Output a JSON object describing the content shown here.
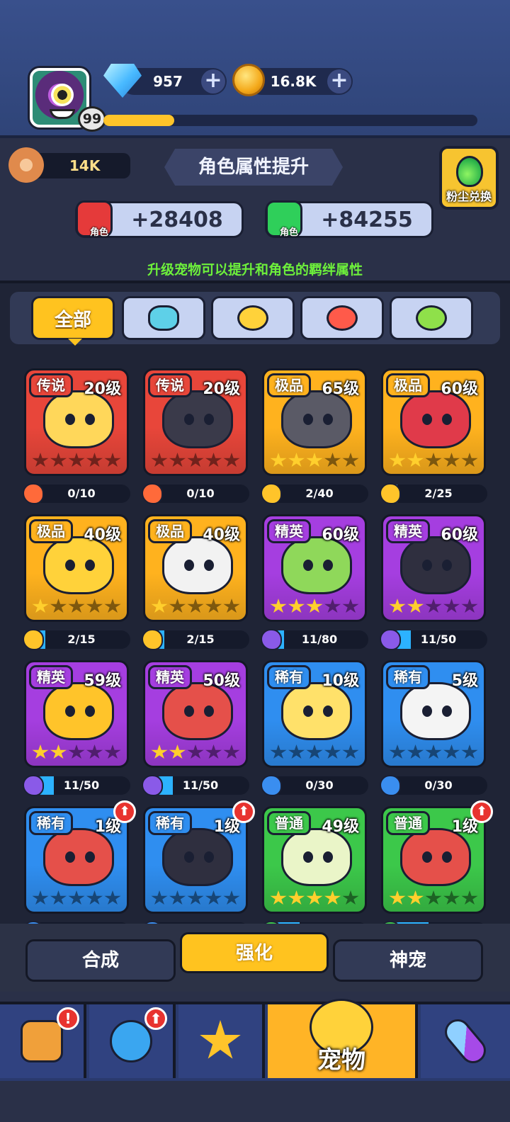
{
  "player": {
    "level": "99",
    "xp_progress": 0.19
  },
  "currencies": {
    "gems": "957",
    "coins": "16.8K",
    "plus": "+"
  },
  "dust": {
    "amount": "14K"
  },
  "header": {
    "title": "角色属性提升",
    "exchange_label": "粉尘兑换"
  },
  "stats": [
    {
      "icon": "sword-icon",
      "icon_label": "角色",
      "value": "+28408",
      "color": "#e53a3a"
    },
    {
      "icon": "heart-icon",
      "icon_label": "角色",
      "value": "+84255",
      "color": "#2fcf5a"
    }
  ],
  "hint": "升级宠物可以提升和角色的羁绊属性",
  "filter_tabs": [
    {
      "label": "全部",
      "icon": "all",
      "active": true
    },
    {
      "label": "",
      "icon": "robot-face-icon",
      "color": "#5ed0e8"
    },
    {
      "label": "",
      "icon": "chick-icon",
      "color": "#ffd23a"
    },
    {
      "label": "",
      "icon": "fire-blob-icon",
      "color": "#ff5a4a"
    },
    {
      "label": "",
      "icon": "dragon-icon",
      "color": "#8fe04a"
    }
  ],
  "pets": [
    {
      "rarity": "传说",
      "level": "20级",
      "stars": 0,
      "progress": "0/10",
      "fill": 0,
      "bg": "#e8463a",
      "art": "#ffd75a",
      "shard": "#ff6a3a",
      "tag": "#e8463a"
    },
    {
      "rarity": "传说",
      "level": "20级",
      "stars": 0,
      "progress": "0/10",
      "fill": 0,
      "bg": "#e8463a",
      "art": "#3a3a4a",
      "shard": "#ff6a3a",
      "tag": "#e8463a"
    },
    {
      "rarity": "极品",
      "level": "65级",
      "stars": 3,
      "progress": "2/40",
      "fill": 0.05,
      "bg": "#ffb21e",
      "art": "#5a5a66",
      "shard": "#ffc42a",
      "tag": "#ffb21e"
    },
    {
      "rarity": "极品",
      "level": "60级",
      "stars": 2,
      "progress": "2/25",
      "fill": 0.08,
      "bg": "#ffb21e",
      "art": "#e03a4a",
      "shard": "#ffc42a",
      "tag": "#ffb21e"
    },
    {
      "rarity": "极品",
      "level": "40级",
      "stars": 1,
      "progress": "2/15",
      "fill": 0.13,
      "bg": "#ffb21e",
      "art": "#ffd23a",
      "shard": "#ffc42a",
      "tag": "#ffb21e"
    },
    {
      "rarity": "极品",
      "level": "40级",
      "stars": 1,
      "progress": "2/15",
      "fill": 0.13,
      "bg": "#ffb21e",
      "art": "#f2f2f2",
      "shard": "#ffc42a",
      "tag": "#ffb21e"
    },
    {
      "rarity": "精英",
      "level": "60级",
      "stars": 3,
      "progress": "11/80",
      "fill": 0.14,
      "bg": "#a53ee0",
      "art": "#8fd85a",
      "shard": "#8a5ae8",
      "tag": "#a53ee0"
    },
    {
      "rarity": "精英",
      "level": "60级",
      "stars": 2,
      "progress": "11/50",
      "fill": 0.22,
      "bg": "#a53ee0",
      "art": "#2f2f3f",
      "shard": "#8a5ae8",
      "tag": "#a53ee0"
    },
    {
      "rarity": "精英",
      "level": "59级",
      "stars": 2,
      "progress": "11/50",
      "fill": 0.22,
      "bg": "#a53ee0",
      "art": "#ffc42a",
      "shard": "#8a5ae8",
      "tag": "#a53ee0"
    },
    {
      "rarity": "精英",
      "level": "50级",
      "stars": 2,
      "progress": "11/50",
      "fill": 0.22,
      "bg": "#a53ee0",
      "art": "#e5504a",
      "shard": "#8a5ae8",
      "tag": "#a53ee0"
    },
    {
      "rarity": "稀有",
      "level": "10级",
      "stars": 0,
      "progress": "0/30",
      "fill": 0,
      "bg": "#2f8ef0",
      "art": "#ffe16a",
      "shard": "#3a8ef0",
      "tag": "#2f8ef0"
    },
    {
      "rarity": "稀有",
      "level": "5级",
      "stars": 0,
      "progress": "0/30",
      "fill": 0,
      "bg": "#2f8ef0",
      "art": "#f4f4f4",
      "shard": "#3a8ef0",
      "tag": "#2f8ef0"
    },
    {
      "rarity": "稀有",
      "level": "1级",
      "stars": 0,
      "progress": "",
      "fill": 0,
      "bg": "#2f8ef0",
      "art": "#e5504a",
      "shard": "#3a8ef0",
      "tag": "#2f8ef0",
      "upgrade": true
    },
    {
      "rarity": "稀有",
      "level": "1级",
      "stars": 0,
      "progress": "",
      "fill": 0,
      "bg": "#2f8ef0",
      "art": "#2f2f3f",
      "shard": "#3a8ef0",
      "tag": "#2f8ef0",
      "upgrade": true
    },
    {
      "rarity": "普通",
      "level": "49级",
      "stars": 4,
      "progress": "",
      "fill": 0.3,
      "bg": "#3cc84a",
      "art": "#eaf5c8",
      "shard": "#3cc84a",
      "tag": "#3cc84a"
    },
    {
      "rarity": "普通",
      "level": "1级",
      "stars": 2,
      "progress": "",
      "fill": 0.4,
      "bg": "#3cc84a",
      "art": "#e5504a",
      "shard": "#3cc84a",
      "tag": "#3cc84a",
      "upgrade": true
    }
  ],
  "sub_tabs": {
    "merge": "合成",
    "enhance": "强化",
    "divine": "神宠"
  },
  "nav": [
    {
      "icon": "shop-house-icon",
      "alert": "!"
    },
    {
      "icon": "ring-icon",
      "alert": "⬆"
    },
    {
      "icon": "star-weapons-icon"
    },
    {
      "icon": "chick-egg-icon",
      "label": "宠物",
      "active": true
    },
    {
      "icon": "capsule-icon"
    }
  ],
  "upgrade_glyph": "⬆"
}
